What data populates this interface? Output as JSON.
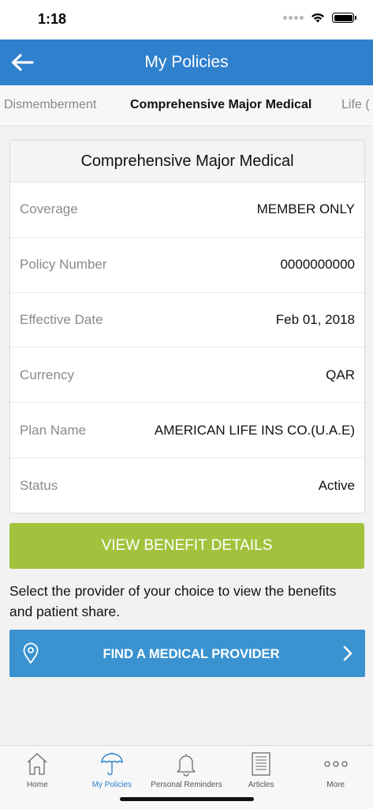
{
  "status_bar": {
    "time": "1:18"
  },
  "header": {
    "title": "My Policies",
    "back_icon": "arrow-left-icon"
  },
  "tabs": [
    {
      "label": "Dismemberment"
    },
    {
      "label": "Comprehensive Major Medical"
    },
    {
      "label": "Life ("
    }
  ],
  "policy": {
    "title": "Comprehensive Major Medical",
    "rows": [
      {
        "label": "Coverage",
        "value": "MEMBER ONLY"
      },
      {
        "label": "Policy Number",
        "value": "0000000000"
      },
      {
        "label": "Effective Date",
        "value": "Feb 01, 2018"
      },
      {
        "label": "Currency",
        "value": "QAR"
      },
      {
        "label": "Plan Name",
        "value": "AMERICAN LIFE INS CO.(U.A.E)"
      },
      {
        "label": "Status",
        "value": "Active"
      }
    ]
  },
  "benefit_button": {
    "label": "VIEW BENEFIT DETAILS"
  },
  "info_text": "Select the provider of your choice to view the benefits and patient share.",
  "provider_button": {
    "label": "FIND A MEDICAL PROVIDER",
    "icon": "location-pin-icon"
  },
  "bottom_nav": [
    {
      "label": "Home",
      "icon": "home-icon"
    },
    {
      "label": "My Policies",
      "icon": "umbrella-icon",
      "active": true
    },
    {
      "label": "Personal Reminders",
      "icon": "bell-icon"
    },
    {
      "label": "Articles",
      "icon": "article-icon"
    },
    {
      "label": "More",
      "icon": "more-icon"
    }
  ],
  "colors": {
    "header": "#2f80cd",
    "benefit_button": "#a2c23d",
    "provider_button": "#3a93d0",
    "active_tab": "#2f80cd"
  }
}
